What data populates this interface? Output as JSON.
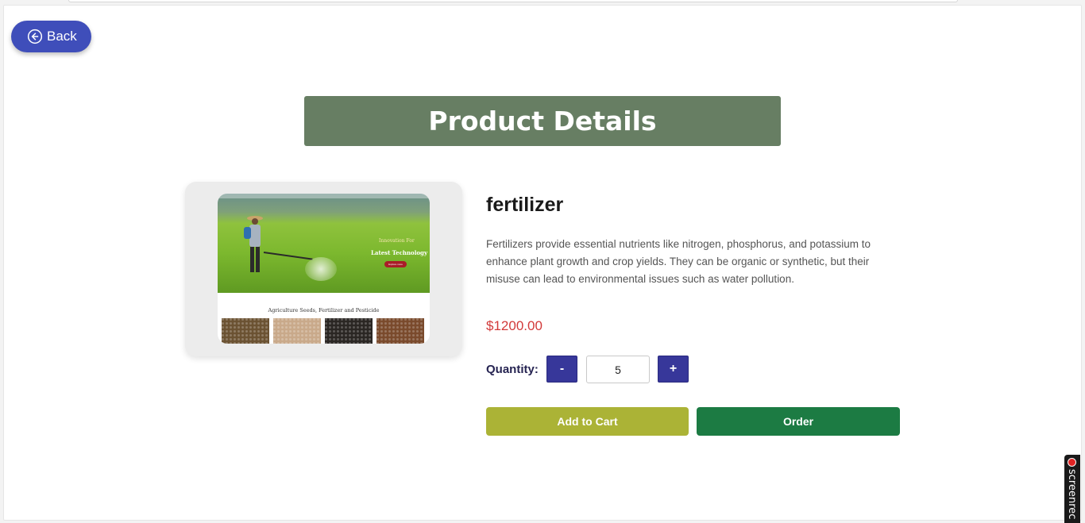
{
  "nav": {
    "back_label": "Back"
  },
  "header": {
    "title": "Product Details"
  },
  "product": {
    "name": "fertilizer",
    "description": "Fertilizers provide essential nutrients like nitrogen, phosphorus, and potassium to enhance plant growth and crop yields. They can be organic or synthetic, but their misuse can lead to environmental issues such as water pollution.",
    "price": "$1200.00",
    "image": {
      "hero_line1": "Innovation For",
      "hero_line2": "Latest Technology",
      "hero_button": "Explore more",
      "section_title": "Agriculture Seeds, Fertilizer and Pesticide",
      "thumb_colors": [
        "#6b5232",
        "#c9a98a",
        "#2a2623",
        "#7a4a2c"
      ]
    }
  },
  "quantity": {
    "label": "Quantity:",
    "minus_label": "-",
    "plus_label": "+",
    "value": "5"
  },
  "actions": {
    "add_to_cart": "Add to Cart",
    "order": "Order"
  },
  "overlay": {
    "recorder_text": "screenrec"
  },
  "colors": {
    "accent_blue": "#3f4eba",
    "title_bg": "#677e63",
    "price": "#d23a3a",
    "cart": "#abb336",
    "order": "#1c7b43"
  }
}
